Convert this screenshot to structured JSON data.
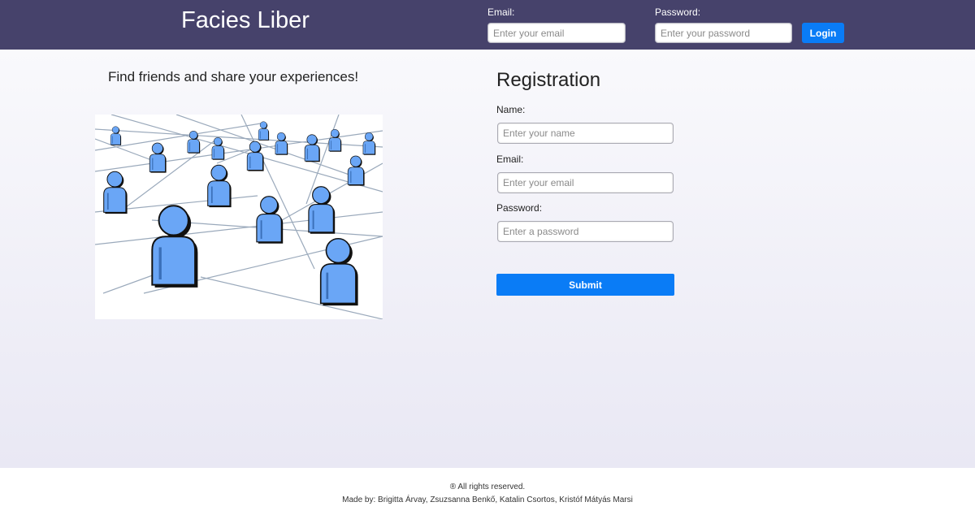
{
  "header": {
    "brand": "Facies Liber",
    "email_label": "Email:",
    "email_placeholder": "Enter your email",
    "password_label": "Password:",
    "password_placeholder": "Enter your password",
    "login_label": "Login"
  },
  "main": {
    "tagline": "Find friends and share your experiences!",
    "illustration_icon": "people-network-icon"
  },
  "registration": {
    "title": "Registration",
    "name_label": "Name:",
    "name_placeholder": "Enter your name",
    "email_label": "Email:",
    "email_placeholder": "Enter your email",
    "password_label": "Password:",
    "password_placeholder": "Enter a password",
    "submit_label": "Submit"
  },
  "footer": {
    "rights": "® All rights reserved.",
    "credits": "Made by: Brigitta Árvay, Zsuzsanna Benkő, Katalin Csortos, Kristóf Mátyás Marsi"
  },
  "colors": {
    "header_bg": "#46426b",
    "accent": "#0a7cf6",
    "figure_blue": "#6aa6f6"
  }
}
